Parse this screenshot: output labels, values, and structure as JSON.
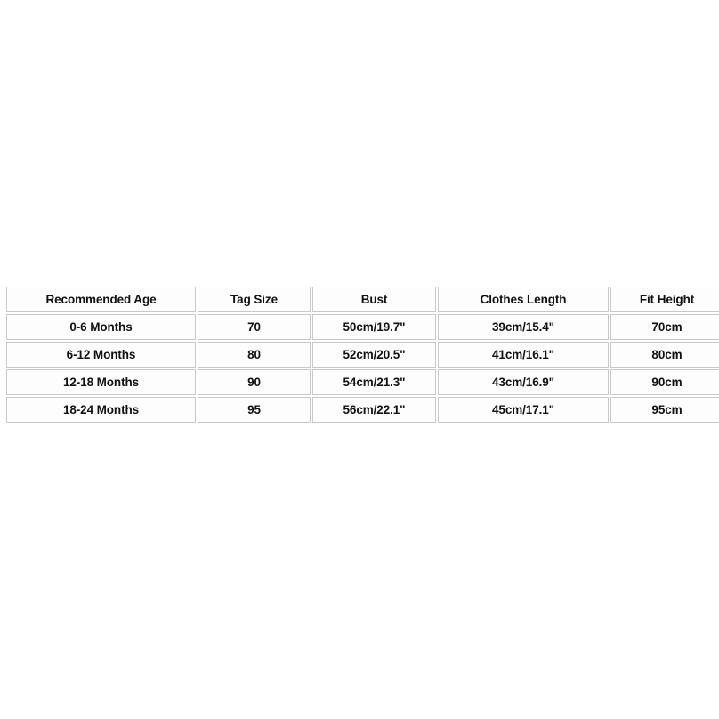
{
  "page": {
    "background_color": "#ffffff",
    "cell_background_color": "#fdfdfd",
    "cell_border_color": "#c8c8c8",
    "text_color": "#111111"
  },
  "chart_data": {
    "type": "table",
    "title": "",
    "columns": [
      "Recommended Age",
      "Tag Size",
      "Bust",
      "Clothes Length",
      "Fit Height"
    ],
    "rows": [
      [
        "0-6 Months",
        "70",
        "50cm/19.7\"",
        "39cm/15.4\"",
        "70cm"
      ],
      [
        "6-12 Months",
        "80",
        "52cm/20.5\"",
        "41cm/16.1\"",
        "80cm"
      ],
      [
        "12-18 Months",
        "90",
        "54cm/21.3\"",
        "43cm/16.9\"",
        "90cm"
      ],
      [
        "18-24 Months",
        "95",
        "56cm/22.1\"",
        "45cm/17.1\"",
        "95cm"
      ]
    ]
  }
}
